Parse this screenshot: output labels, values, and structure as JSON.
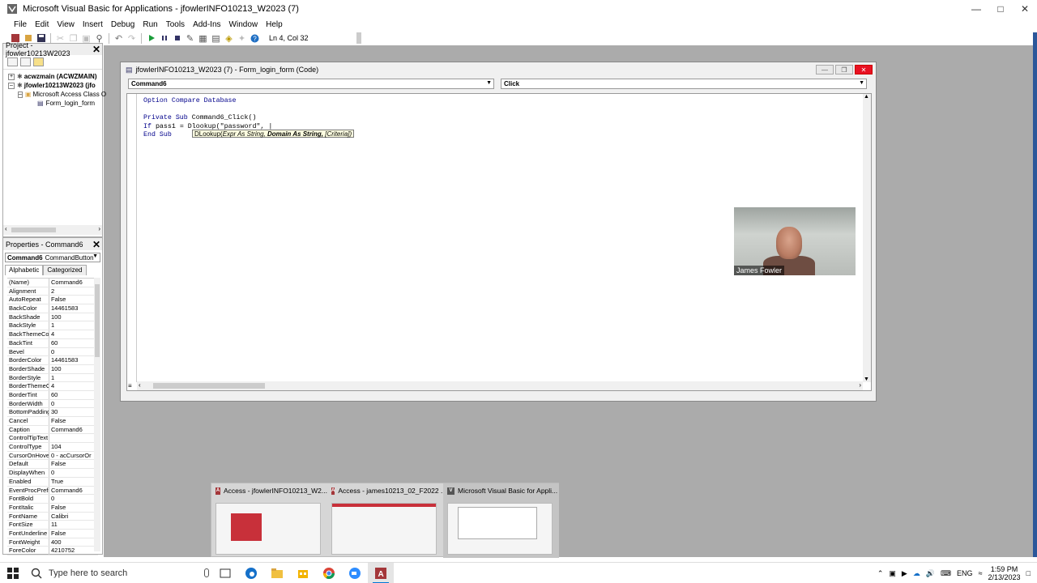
{
  "window": {
    "title": "Microsoft Visual Basic for Applications - jfowlerINFO10213_W2023 (7)"
  },
  "menu": [
    "File",
    "Edit",
    "View",
    "Insert",
    "Debug",
    "Run",
    "Tools",
    "Add-Ins",
    "Window",
    "Help"
  ],
  "toolbar": {
    "position": "Ln 4, Col 32"
  },
  "project": {
    "title": "Project - jfowler10213W2023",
    "tree": [
      {
        "label": "acwzmain (ACWZMAIN)",
        "bold": true,
        "expander": "+"
      },
      {
        "label": "jfowler10213W2023 (jfo",
        "bold": true,
        "expander": "-"
      },
      {
        "label": "Microsoft Access Class O",
        "bold": false,
        "expander": "-"
      },
      {
        "label": "Form_login_form",
        "bold": false,
        "expander": ""
      }
    ]
  },
  "properties": {
    "title": "Properties - Command6",
    "object_name": "Command6",
    "object_type": "CommandButton",
    "tab_alphabetic": "Alphabetic",
    "tab_categorized": "Categorized",
    "rows": [
      [
        "(Name)",
        "Command6"
      ],
      [
        "Alignment",
        "2"
      ],
      [
        "AutoRepeat",
        "False"
      ],
      [
        "BackColor",
        "14461583"
      ],
      [
        "BackShade",
        "100"
      ],
      [
        "BackStyle",
        "1"
      ],
      [
        "BackThemeColor",
        "4"
      ],
      [
        "BackTint",
        "60"
      ],
      [
        "Bevel",
        "0"
      ],
      [
        "BorderColor",
        "14461583"
      ],
      [
        "BorderShade",
        "100"
      ],
      [
        "BorderStyle",
        "1"
      ],
      [
        "BorderThemeCo",
        "4"
      ],
      [
        "BorderTint",
        "60"
      ],
      [
        "BorderWidth",
        "0"
      ],
      [
        "BottomPadding",
        "30"
      ],
      [
        "Cancel",
        "False"
      ],
      [
        "Caption",
        "Command6"
      ],
      [
        "ControlTipText",
        ""
      ],
      [
        "ControlType",
        "104"
      ],
      [
        "CursorOnHover",
        "0 - acCursorOr"
      ],
      [
        "Default",
        "False"
      ],
      [
        "DisplayWhen",
        "0"
      ],
      [
        "Enabled",
        "True"
      ],
      [
        "EventProcPrefix",
        "Command6"
      ],
      [
        "FontBold",
        "0"
      ],
      [
        "FontItalic",
        "False"
      ],
      [
        "FontName",
        "Calibri"
      ],
      [
        "FontSize",
        "11"
      ],
      [
        "FontUnderline",
        "False"
      ],
      [
        "FontWeight",
        "400"
      ],
      [
        "ForeColor",
        "4210752"
      ]
    ]
  },
  "code_window": {
    "title": "jfowlerINFO10213_W2023 (7) - Form_login_form (Code)",
    "object_combo": "Command6",
    "proc_combo": "Click",
    "lines": [
      {
        "kw": "Option Compare Database",
        "rest": ""
      },
      {
        "kw": "",
        "rest": ""
      },
      {
        "kw": "Private Sub",
        "rest": " Command6_Click()"
      },
      {
        "kw": "If",
        "rest": " pass1 = Dlookup(\"password\", |"
      },
      {
        "kw": "End Sub",
        "rest": ""
      }
    ],
    "tooltip_fn": "DLookup(",
    "tooltip_arg1": "Expr As String,",
    "tooltip_arg2": "Domain As String,",
    "tooltip_arg3": "[Criteria])"
  },
  "webcam": {
    "name": "James Fowler"
  },
  "task_thumbnails": [
    {
      "title": "Access - jfowlerINFO10213_W2...",
      "icon": "A"
    },
    {
      "title": "Access - james10213_02_F2022 ...",
      "icon": "A"
    },
    {
      "title": "Microsoft Visual Basic for Appli...",
      "icon": "V"
    }
  ],
  "taskbar": {
    "search_placeholder": "Type here to search",
    "lang": "ENG",
    "time": "1:59 PM",
    "date": "2/13/2023"
  }
}
